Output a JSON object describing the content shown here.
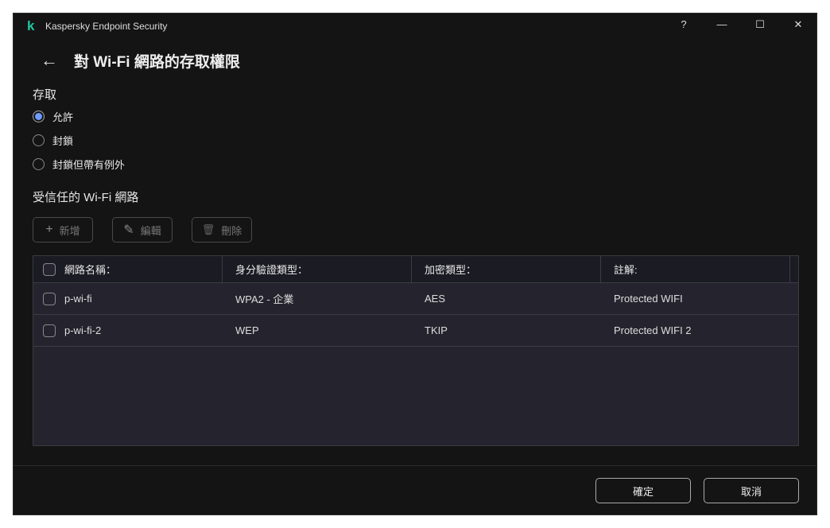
{
  "window": {
    "title": "Kaspersky Endpoint Security",
    "help": "?",
    "minimize": "—",
    "maximize": "☐",
    "close": "✕",
    "logo": "k"
  },
  "page": {
    "back": "←",
    "title": "對 Wi-Fi 網路的存取權限"
  },
  "access": {
    "heading": "存取",
    "options": [
      {
        "label": "允許",
        "selected": true
      },
      {
        "label": "封鎖",
        "selected": false
      },
      {
        "label": "封鎖但帶有例外",
        "selected": false
      }
    ]
  },
  "trusted": {
    "heading": "受信任的 Wi-Fi 網路"
  },
  "toolbar": {
    "add": "新增",
    "add_icon": "+",
    "edit": "編輯",
    "edit_icon": "✎",
    "delete": "刪除",
    "delete_icon": "🗑"
  },
  "table": {
    "headers": [
      "網路名稱：",
      "身分驗證類型：",
      "加密類型：",
      "註解:"
    ],
    "rows": [
      [
        "p-wi-fi",
        "WPA2 - 企業",
        "AES",
        "Protected WIFI"
      ],
      [
        "p-wi-fi-2",
        "WEP",
        "TKIP",
        "Protected WIFI 2"
      ]
    ]
  },
  "footer": {
    "ok": "確定",
    "cancel": "取消"
  }
}
